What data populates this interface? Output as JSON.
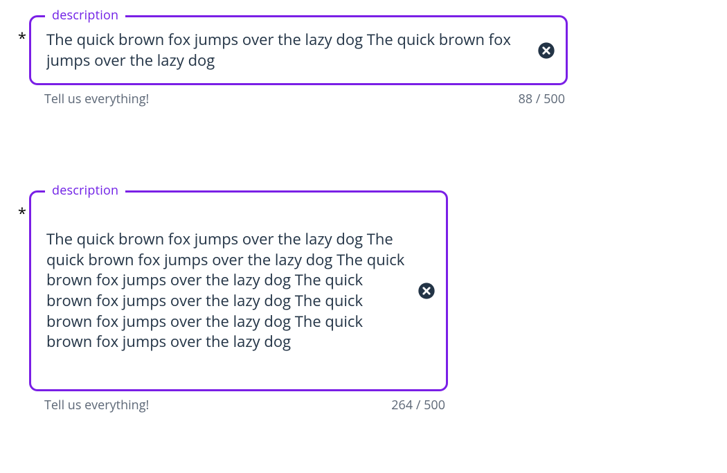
{
  "shared": {
    "required_marker": "*"
  },
  "field1": {
    "label": "description",
    "value": "The quick brown fox jumps over the lazy dog The quick brown fox jumps over the lazy dog",
    "helper": "Tell us everything!",
    "count": "88",
    "max": "500"
  },
  "field2": {
    "label": "description",
    "value": "The quick brown fox jumps over the lazy dog The quick brown fox jumps over the lazy dog The quick brown fox jumps over the lazy dog The quick brown fox jumps over the lazy dog The quick brown fox jumps over the lazy dog The quick brown fox jumps over the lazy dog",
    "helper": "Tell us everything!",
    "count": "264",
    "max": "500"
  }
}
